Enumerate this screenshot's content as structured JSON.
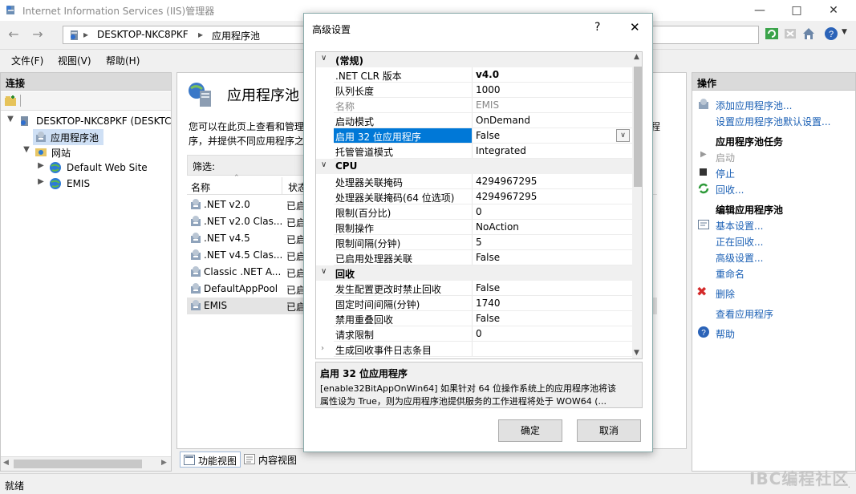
{
  "window": {
    "title": "Internet Information Services (IIS)管理器",
    "address": {
      "server": "DESKTOP-NKC8PKF",
      "page": "应用程序池"
    }
  },
  "menu": [
    "文件(F)",
    "视图(V)",
    "帮助(H)"
  ],
  "connections": {
    "header": "连接",
    "server_node": "DESKTOP-NKC8PKF (DESKTC",
    "app_pools_node": "应用程序池",
    "sites_node": "网站",
    "sites": [
      "Default Web Site",
      "EMIS"
    ]
  },
  "main": {
    "title": "应用程序池",
    "description_line1": "您可以在此页上查看和管理",
    "description_line2": "序，并提供不同应用程序之",
    "description_tail": "程",
    "filter_label": "筛选:",
    "columns": {
      "name": "名称",
      "state": "状态"
    },
    "pools": [
      {
        "name": ".NET v2.0",
        "state": "已启"
      },
      {
        "name": ".NET v2.0 Clas...",
        "state": "已启"
      },
      {
        "name": ".NET v4.5",
        "state": "已启"
      },
      {
        "name": ".NET v4.5 Clas...",
        "state": "已启"
      },
      {
        "name": "Classic .NET A...",
        "state": "已启"
      },
      {
        "name": "DefaultAppPool",
        "state": "已启"
      },
      {
        "name": "EMIS",
        "state": "已启"
      }
    ],
    "view_tabs": {
      "features": "功能视图",
      "content": "内容视图"
    }
  },
  "actions": {
    "header": "操作",
    "add_pool": "添加应用程序池...",
    "set_defaults": "设置应用程序池默认设置...",
    "tasks_header": "应用程序池任务",
    "start": "启动",
    "stop": "停止",
    "recycle": "回收...",
    "edit_header": "编辑应用程序池",
    "basic": "基本设置...",
    "recycling": "正在回收...",
    "advanced": "高级设置...",
    "rename": "重命名",
    "delete": "删除",
    "view_apps": "查看应用程序",
    "help": "帮助"
  },
  "status": {
    "text": "就绪"
  },
  "watermark": "IBC编程社区",
  "dialog": {
    "title": "高级设置",
    "help_glyph": "?",
    "categories": {
      "general": "(常规)",
      "cpu": "CPU",
      "recycling": "回收"
    },
    "general_props": [
      {
        "name": ".NET CLR 版本",
        "value": "v4.0"
      },
      {
        "name": "队列长度",
        "value": "1000"
      },
      {
        "name": "名称",
        "value": "EMIS"
      },
      {
        "name": "启动模式",
        "value": "OnDemand"
      },
      {
        "name": "启用 32 位应用程序",
        "value": "False"
      },
      {
        "name": "托管管道模式",
        "value": "Integrated"
      }
    ],
    "cpu_props": [
      {
        "name": "处理器关联掩码",
        "value": "4294967295"
      },
      {
        "name": "处理器关联掩码(64 位选项)",
        "value": "4294967295"
      },
      {
        "name": "限制(百分比)",
        "value": "0"
      },
      {
        "name": "限制操作",
        "value": "NoAction"
      },
      {
        "name": "限制间隔(分钟)",
        "value": "5"
      },
      {
        "name": "已启用处理器关联",
        "value": "False"
      }
    ],
    "recycling_props": [
      {
        "name": "发生配置更改时禁止回收",
        "value": "False"
      },
      {
        "name": "固定时间间隔(分钟)",
        "value": "1740"
      },
      {
        "name": "禁用重叠回收",
        "value": "False"
      },
      {
        "name": "请求限制",
        "value": "0"
      },
      {
        "name": "生成回收事件日志条目",
        "value": ""
      }
    ],
    "description": {
      "title": "启用 32 位应用程序",
      "line1": "[enable32BitAppOnWin64] 如果针对 64 位操作系统上的应用程序池将该",
      "line2": "属性设为 True，则为应用程序池提供服务的工作进程将处于 WOW64 (..."
    },
    "ok": "确定",
    "cancel": "取消"
  },
  "colors": {
    "accent_link": "#1a5fb4",
    "selection": "#0078d7"
  }
}
